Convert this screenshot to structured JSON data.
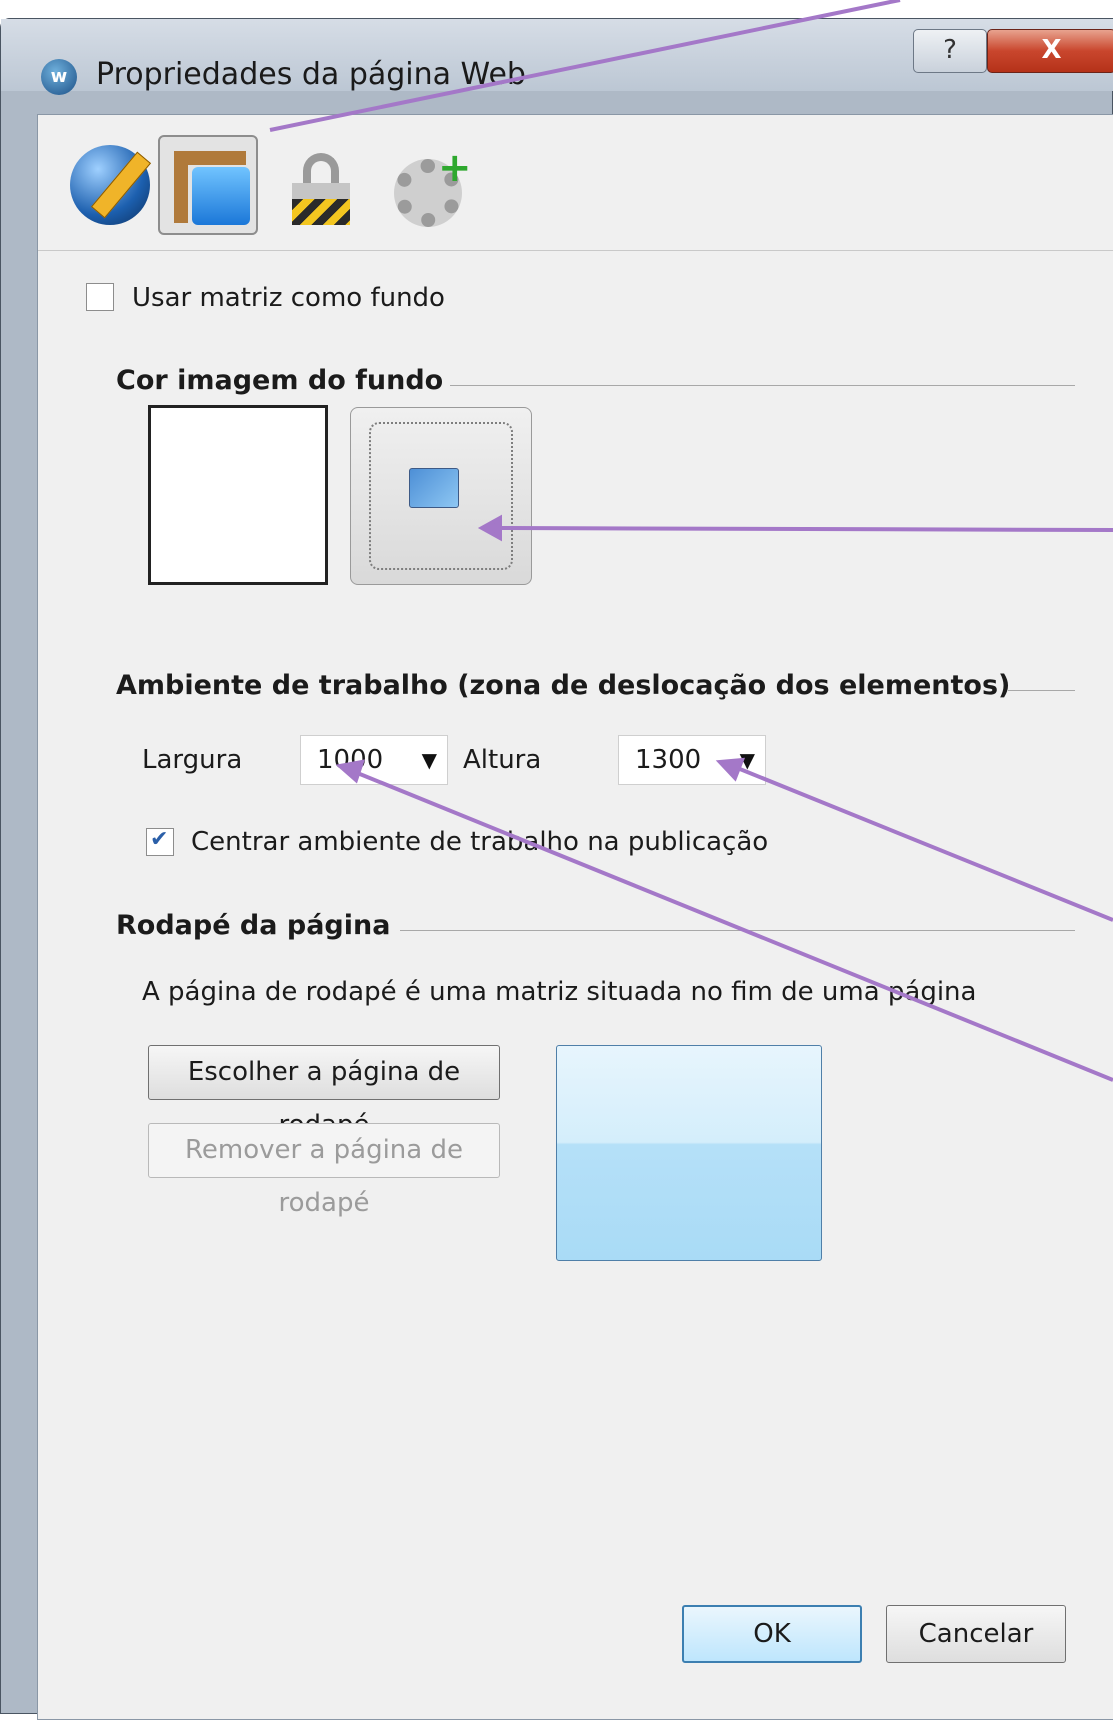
{
  "window": {
    "title": "Propriedades da página Web",
    "app_icon_letter": "w",
    "help_label": "?",
    "close_label": "X"
  },
  "toolbar": {
    "tabs": [
      {
        "icon": "globe-pencil-icon",
        "selected": false
      },
      {
        "icon": "layout-icon",
        "selected": true
      },
      {
        "icon": "lock-icon",
        "selected": false
      },
      {
        "icon": "gear-plus-icon",
        "selected": false
      }
    ]
  },
  "master_bg": {
    "label": "Usar matriz como fundo",
    "checked": false
  },
  "background": {
    "section_title": "Cor  imagem do fundo",
    "color_value": "#ffffff"
  },
  "workspace": {
    "section_title": "Ambiente de trabalho (zona de deslocação dos elementos)",
    "width_label": "Largura",
    "width_value": "1000",
    "height_label": "Altura",
    "height_value": "1300",
    "center_label": "Centrar ambiente de trabalho na publicação",
    "center_checked": true
  },
  "footer": {
    "section_title": "Rodapé da página",
    "description": "A página de rodapé é uma matriz situada no fim de uma página",
    "choose_label": "Escolher a página de rodapé",
    "remove_label": "Remover a página de rodapé"
  },
  "actions": {
    "ok_label": "OK",
    "cancel_label": "Cancelar"
  },
  "colors": {
    "annotation": "#a478c8",
    "close_red": "#c9462d",
    "default_button_border": "#3c7fb1"
  }
}
